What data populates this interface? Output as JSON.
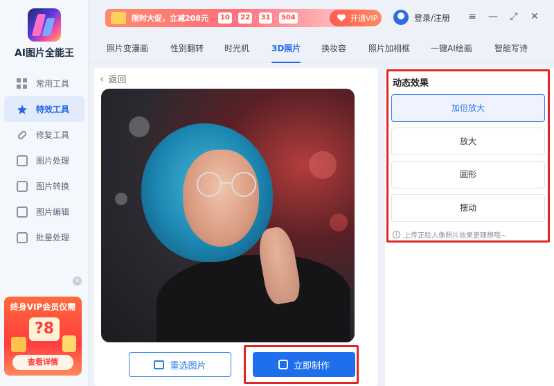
{
  "app": {
    "title": "AI图片全能王"
  },
  "sidebar": {
    "items": [
      {
        "label": "常用工具"
      },
      {
        "label": "特效工具"
      },
      {
        "label": "修复工具"
      },
      {
        "label": "图片处理"
      },
      {
        "label": "图片转换"
      },
      {
        "label": "图片编辑"
      },
      {
        "label": "批量处理"
      }
    ],
    "promo": {
      "title": "终身VIP会员仅需",
      "price": "?8",
      "button": "查看详情",
      "close": "×"
    }
  },
  "topbar": {
    "flash_text": "限时大促，立减208元",
    "countdown": [
      "10",
      "22",
      "31",
      "504"
    ],
    "vip_button": "开通VIP",
    "login": "登录/注册",
    "menu_icon": "≡",
    "minimize_icon": "—",
    "maximize_icon": "⤢",
    "close_icon": "✕"
  },
  "tabs": [
    {
      "label": "照片变漫画"
    },
    {
      "label": "性别翻转"
    },
    {
      "label": "时光机"
    },
    {
      "label": "3D照片"
    },
    {
      "label": "换妆容"
    },
    {
      "label": "照片加相框"
    },
    {
      "label": "一键AI绘画"
    },
    {
      "label": "智能写诗"
    }
  ],
  "main": {
    "back": "返回",
    "reselect_button": "重选图片",
    "make_button": "立即制作"
  },
  "effects": {
    "title": "动态效果",
    "options": [
      {
        "label": "加倍放大"
      },
      {
        "label": "放大"
      },
      {
        "label": "圆形"
      },
      {
        "label": "摆动"
      }
    ],
    "tip": "上传正脸人像照片效果更理想哦~"
  },
  "colors": {
    "accent": "#2166e8",
    "highlight_border": "#e02525"
  }
}
